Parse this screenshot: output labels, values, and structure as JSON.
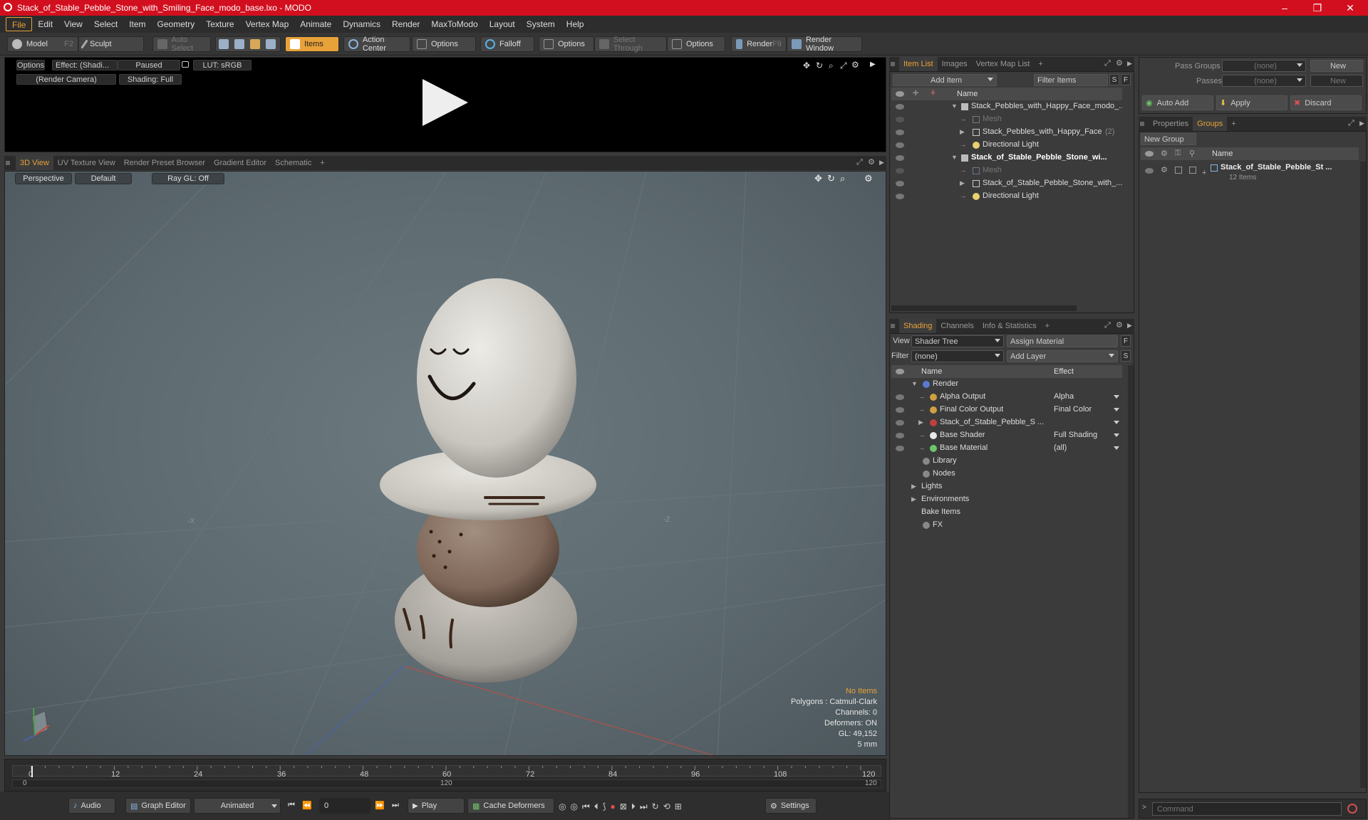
{
  "window": {
    "title": "Stack_of_Stable_Pebble_Stone_with_Smiling_Face_modo_base.lxo - MODO",
    "minimize": "–",
    "maximize": "❐",
    "close": "✕"
  },
  "menu": [
    "File",
    "Edit",
    "View",
    "Select",
    "Item",
    "Geometry",
    "Texture",
    "Vertex Map",
    "Animate",
    "Dynamics",
    "Render",
    "MaxToModo",
    "Layout",
    "System",
    "Help"
  ],
  "toolbar": {
    "model": "Model",
    "model_key": "F2",
    "sculpt": "Sculpt",
    "auto_select": "Auto Select",
    "items": "Items",
    "action_center": "Action Center",
    "options1": "Options",
    "falloff": "Falloff",
    "options2": "Options",
    "select_through": "Select Through",
    "options3": "Options",
    "render": "Render",
    "render_key": "F9",
    "render_window": "Render Window"
  },
  "preview": {
    "options": "Options",
    "effect": "Effect: (Shadi...",
    "paused": "Paused",
    "lut": "LUT: sRGB",
    "camera": "(Render Camera)",
    "shading": "Shading: Full"
  },
  "view_tabs": [
    "3D View",
    "UV Texture View",
    "Render Preset Browser",
    "Gradient Editor",
    "Schematic",
    "+"
  ],
  "viewport": {
    "perspective": "Perspective",
    "default": "Default",
    "raygl": "Ray GL: Off",
    "axis_minus_x": "-X",
    "axis_minus_z": "-Z",
    "stats": {
      "no_items": "No Items",
      "polygons": "Polygons : Catmull-Clark",
      "channels": "Channels: 0",
      "deformers": "Deformers: ON",
      "gl": "GL: 49,152",
      "unit": "5 mm"
    }
  },
  "timeline": {
    "ticks": [
      "0",
      "12",
      "24",
      "36",
      "48",
      "60",
      "72",
      "84",
      "96",
      "108",
      "120"
    ],
    "start": "0",
    "mid": "120",
    "end": "120"
  },
  "bottombar": {
    "audio": "Audio",
    "graph_editor": "Graph Editor",
    "animated": "Animated",
    "frame": "0",
    "play": "Play",
    "cache_deformers": "Cache Deformers",
    "settings": "Settings"
  },
  "item_list": {
    "tabs": [
      "Item List",
      "Images",
      "Vertex Map List",
      "+"
    ],
    "add_item": "Add Item",
    "filter_items": "Filter Items",
    "s": "S",
    "f": "F",
    "col_name": "Name",
    "rows": [
      {
        "label": "Stack_Pebbles_with_Happy_Face_modo_...",
        "indent": 0,
        "bold": false
      },
      {
        "label": "Mesh",
        "indent": 1,
        "bold": false,
        "dim": true
      },
      {
        "label": "Stack_Pebbles_with_Happy_Face",
        "count": "(2)",
        "indent": 1,
        "bold": false
      },
      {
        "label": "Directional Light",
        "indent": 1,
        "bold": false
      },
      {
        "label": "Stack_of_Stable_Pebble_Stone_wi...",
        "indent": 0,
        "bold": true
      },
      {
        "label": "Mesh",
        "indent": 1,
        "bold": false,
        "dim": true
      },
      {
        "label": "Stack_of_Stable_Pebble_Stone_with_...",
        "indent": 1,
        "bold": false
      },
      {
        "label": "Directional Light",
        "indent": 1,
        "bold": false
      }
    ]
  },
  "shading": {
    "tabs": [
      "Shading",
      "Channels",
      "Info & Statistics",
      "+"
    ],
    "view_label": "View",
    "view_value": "Shader Tree",
    "assign_material": "Assign Material",
    "filter_label": "Filter",
    "filter_value": "(none)",
    "add_layer": "Add Layer",
    "f": "F",
    "s": "S",
    "col_name": "Name",
    "col_effect": "Effect",
    "rows": [
      {
        "label": "Render",
        "effect": ""
      },
      {
        "label": "Alpha Output",
        "effect": "Alpha"
      },
      {
        "label": "Final Color Output",
        "effect": "Final Color"
      },
      {
        "label": "Stack_of_Stable_Pebble_S ...",
        "effect": ""
      },
      {
        "label": "Base Shader",
        "effect": "Full Shading"
      },
      {
        "label": "Base Material",
        "effect": "(all)"
      },
      {
        "label": "Library",
        "effect": ""
      },
      {
        "label": "Nodes",
        "effect": ""
      },
      {
        "label": "Lights",
        "effect": ""
      },
      {
        "label": "Environments",
        "effect": ""
      },
      {
        "label": "Bake Items",
        "effect": ""
      },
      {
        "label": "FX",
        "effect": ""
      }
    ]
  },
  "groups_panel": {
    "pass_groups": "Pass Groups",
    "pass_groups_value": "(none)",
    "new": "New",
    "passes": "Passes",
    "passes_value": "(none)",
    "new2": "New",
    "auto_add": "Auto Add",
    "apply": "Apply",
    "discard": "Discard",
    "tabs": [
      "Properties",
      "Groups",
      "+"
    ],
    "new_group": "New Group",
    "col_name": "Name",
    "group_name": "Stack_of_Stable_Pebble_St ...",
    "group_count": "12 Items",
    "command_placeholder": "Command"
  }
}
